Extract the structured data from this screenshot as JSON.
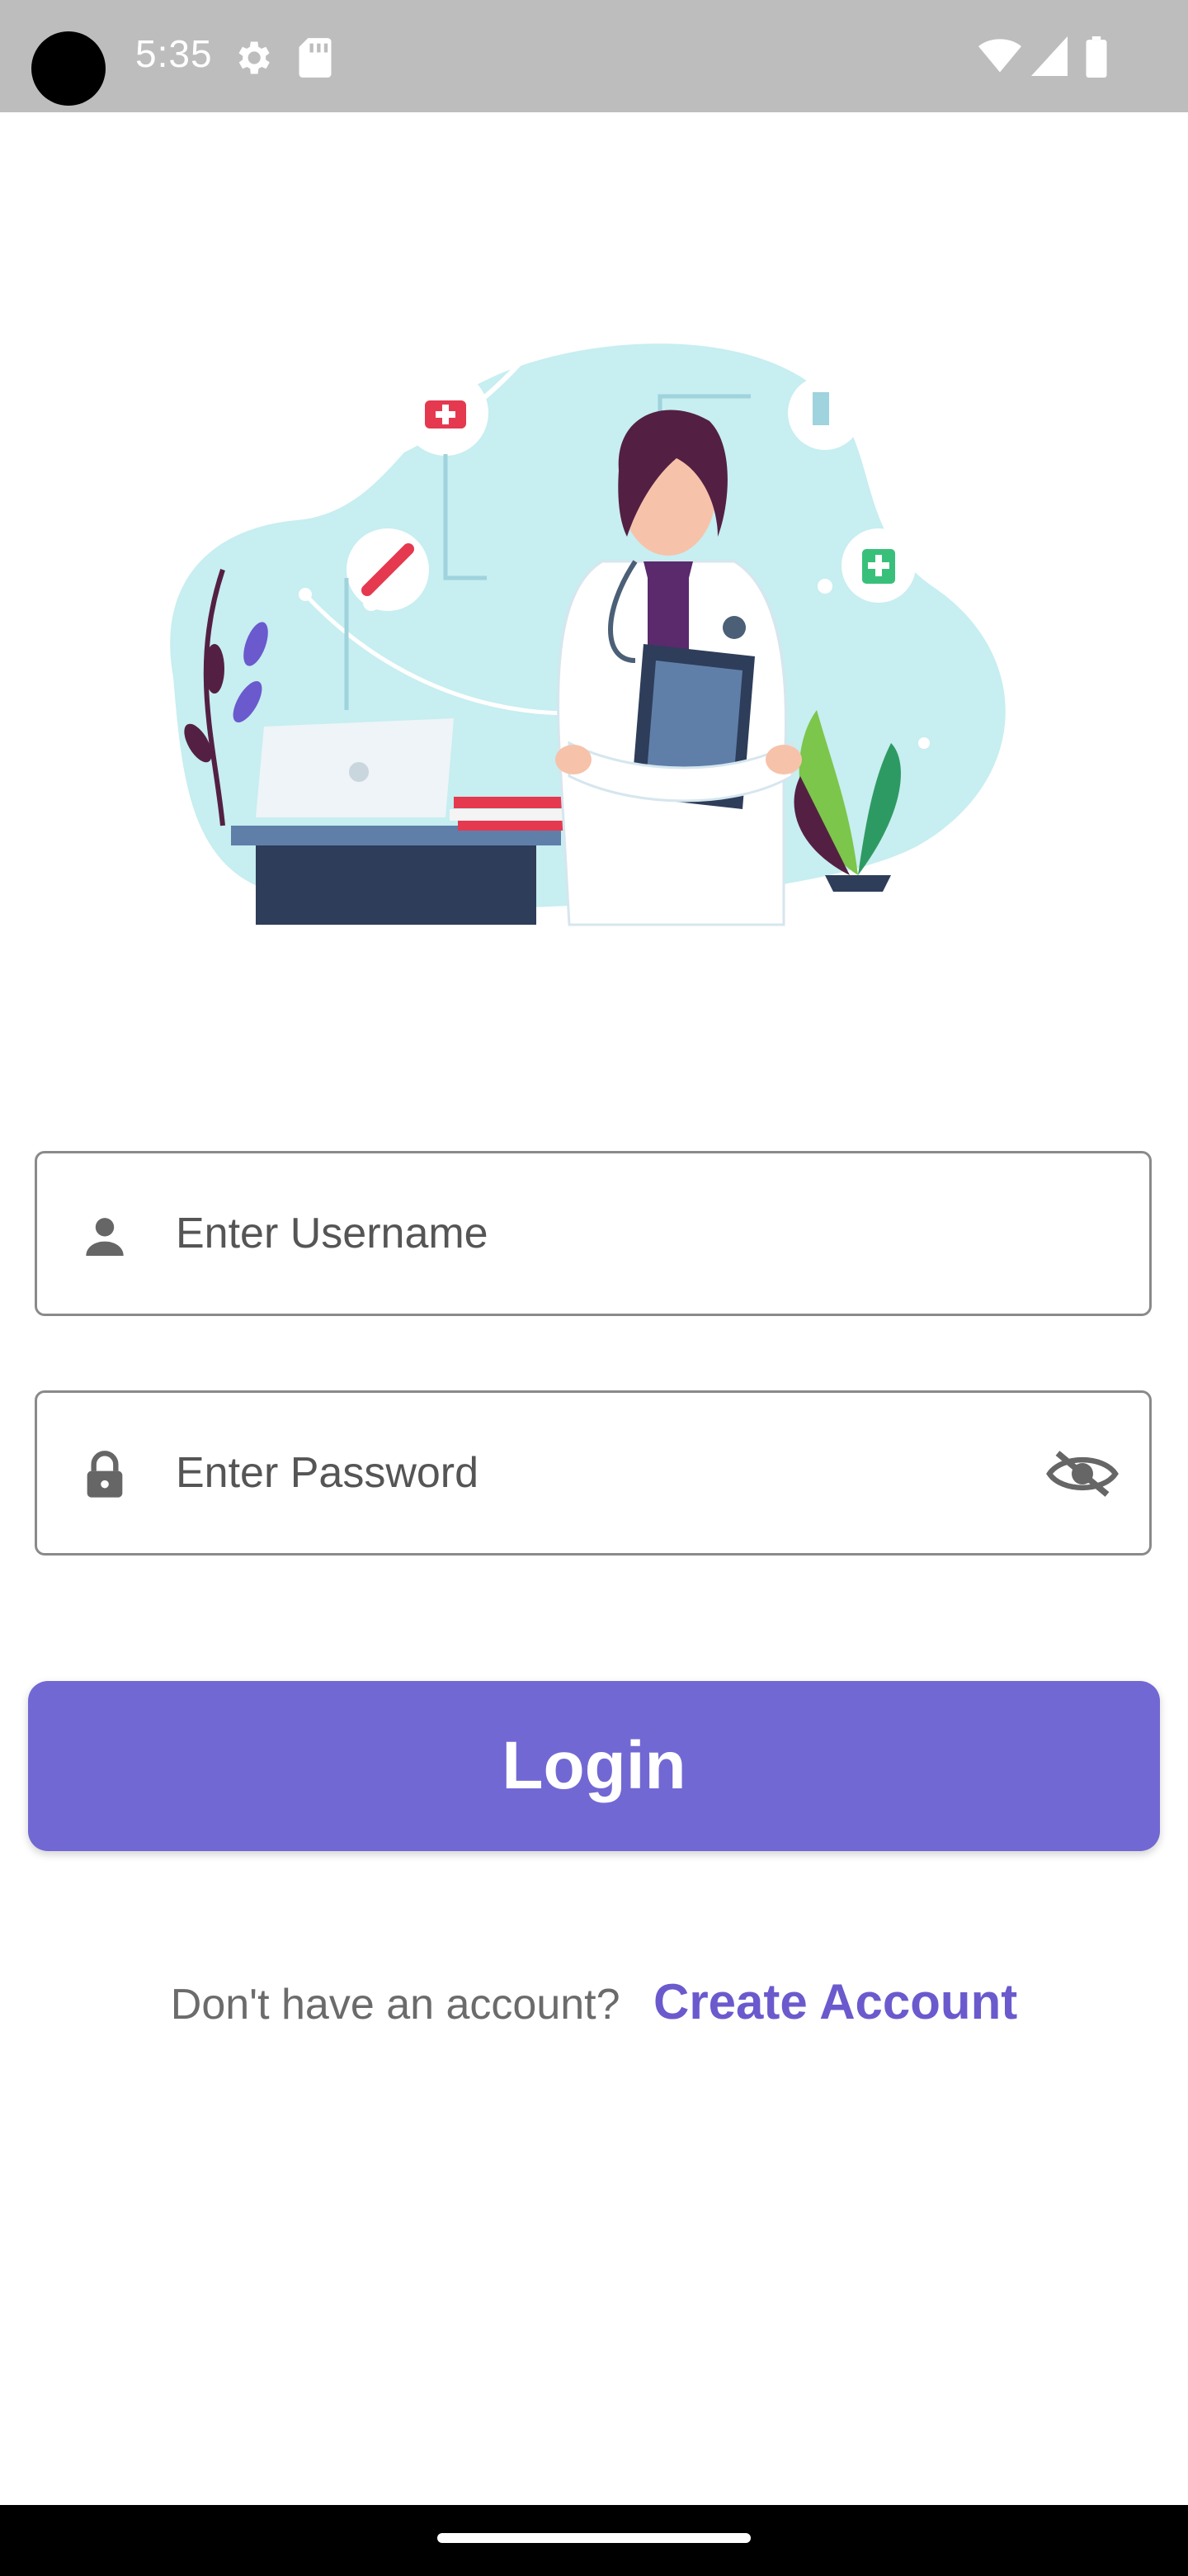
{
  "status_bar": {
    "time": "5:35",
    "icons": [
      "settings-icon",
      "sd-card-icon",
      "wifi-icon",
      "signal-icon",
      "battery-icon"
    ]
  },
  "illustration": {
    "subject": "doctor-illustration",
    "accent_color": "#c7eef0"
  },
  "login_form": {
    "username": {
      "placeholder": "Enter Username",
      "icon": "person-icon"
    },
    "password": {
      "placeholder": "Enter Password",
      "icon": "lock-icon",
      "toggle_icon": "eye-off-icon"
    },
    "login_button": "Login"
  },
  "signup": {
    "prompt": "Don't have an account?",
    "link": "Create Account"
  },
  "colors": {
    "primary": "#7268d4",
    "link": "#6a5acd",
    "status_bar": "#bdbdbd"
  }
}
